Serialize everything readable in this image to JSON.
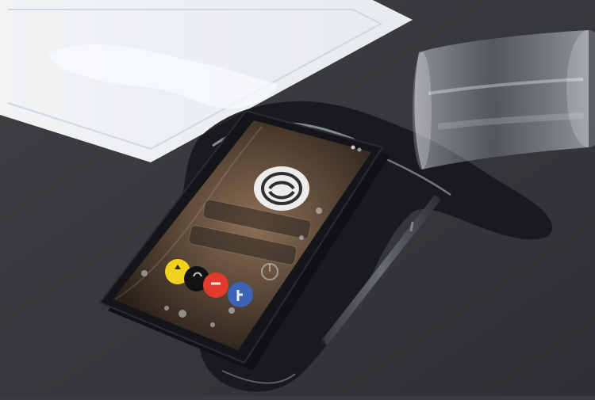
{
  "scene": {
    "description_free": true,
    "colors": {
      "table": "#3a3b3e",
      "paper": "#eef0f2",
      "water_dark": "#1b1c1f",
      "water_highlight": "#dfe3e8",
      "phone_body": "#141518",
      "screen_bg": "#3b2e25",
      "logo_circle": "#f4f4f4",
      "yellow_button": "#f2d21f",
      "red_button": "#e23a2e",
      "blue_button": "#3d63b5",
      "black_button": "#121212"
    }
  },
  "phone": {
    "screen": {
      "inputs": [
        {
          "value": ""
        },
        {
          "value": ""
        }
      ],
      "buttons": [
        {
          "icon": "snapchat-icon"
        },
        {
          "icon": "github-icon"
        },
        {
          "icon": "google-plus-icon"
        },
        {
          "icon": "facebook-icon"
        }
      ],
      "secondary_icon": "power-icon"
    }
  }
}
